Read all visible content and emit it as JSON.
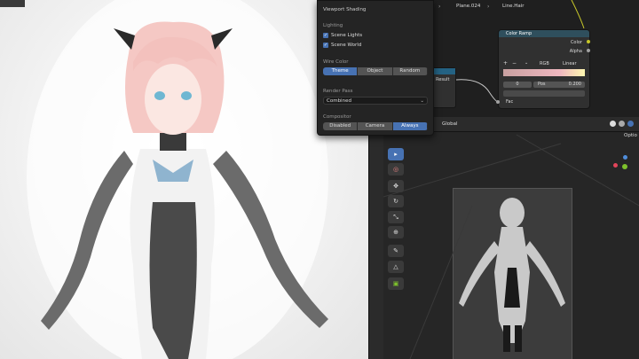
{
  "popover": {
    "title": "Viewport Shading",
    "lighting_label": "Lighting",
    "scene_lights": "Scene Lights",
    "scene_world": "Scene World",
    "wire_color_label": "Wire Color",
    "wire_options": [
      "Theme",
      "Object",
      "Random"
    ],
    "render_pass_label": "Render Pass",
    "render_pass_value": "Combined",
    "compositor_label": "Compositor",
    "compositor_options": [
      "Disabled",
      "Camera",
      "Always"
    ]
  },
  "node_editor": {
    "breadcrumb_1": "Plane.024",
    "breadcrumb_2": "Line.Hair",
    "result_label": "Result"
  },
  "color_ramp": {
    "title": "Color Ramp",
    "out_color": "Color",
    "out_alpha": "Alpha",
    "mode": "RGB",
    "interp": "Linear",
    "stop_index": "0",
    "pos_label": "Pos",
    "pos_value": "0.200",
    "fac_label": "Fac"
  },
  "viewport": {
    "orientation": "Global",
    "options_label": "Optio"
  },
  "colors": {
    "accent": "#4772b3",
    "socket_yellow": "#c7c729",
    "socket_gray": "#a1a1a1"
  }
}
